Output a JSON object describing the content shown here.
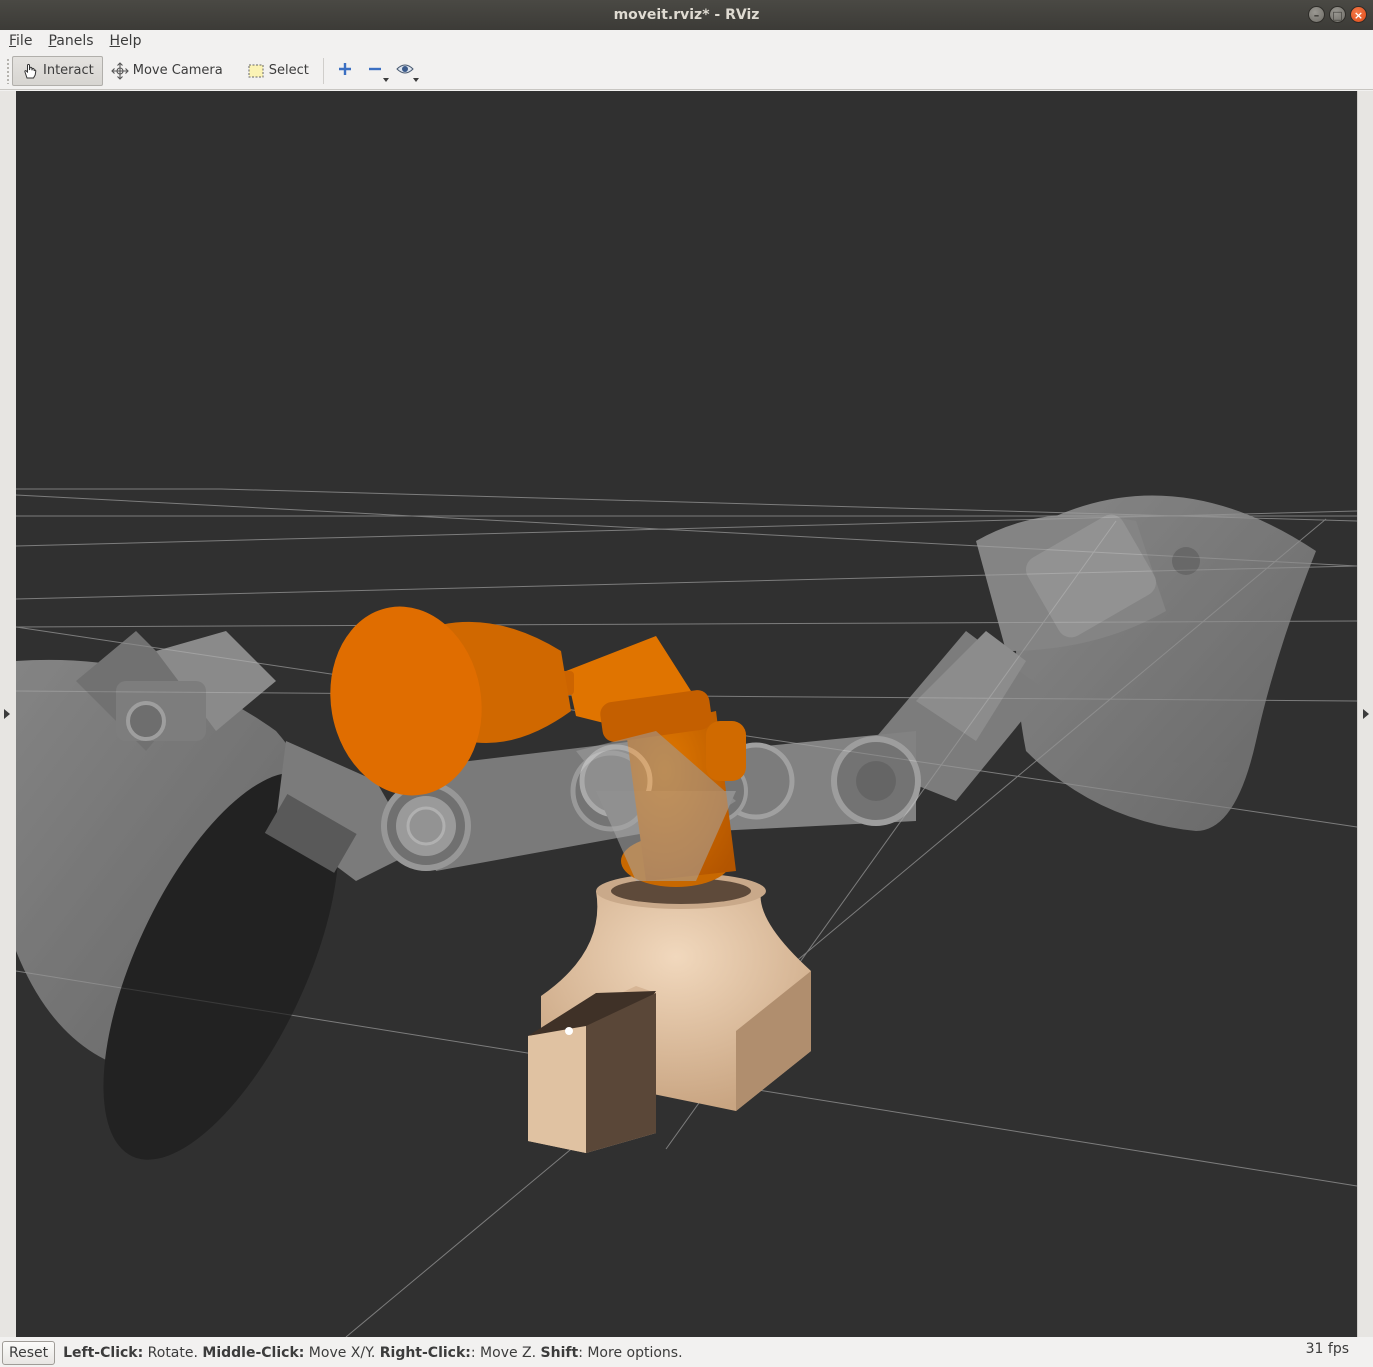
{
  "window": {
    "title": "moveit.rviz* - RViz",
    "controls": [
      "minimize",
      "maximize",
      "close"
    ]
  },
  "menubar": {
    "items": [
      {
        "mnemonic": "F",
        "rest": "ile"
      },
      {
        "mnemonic": "P",
        "rest": "anels"
      },
      {
        "mnemonic": "H",
        "rest": "elp"
      }
    ]
  },
  "toolbar": {
    "interact_label": "Interact",
    "move_camera_label": "Move Camera",
    "select_label": "Select",
    "active_tool": "Interact",
    "icons": [
      "hand-icon",
      "move-camera-icon",
      "select-icon",
      "add-tool-icon",
      "remove-tool-icon",
      "view-icon"
    ]
  },
  "viewport": {
    "background": "#303030",
    "robot_color": "#d96f00",
    "ghost_color": "#9a9a9a",
    "base_color": "#d9b896"
  },
  "statusbar": {
    "reset_label": "Reset",
    "hint": [
      {
        "bold": "Left-Click:",
        "text": " Rotate. "
      },
      {
        "bold": "Middle-Click:",
        "text": " Move X/Y. "
      },
      {
        "bold": "Right-Click:",
        "text": ": Move Z. "
      },
      {
        "bold": "Shift",
        "text": ": More options."
      }
    ],
    "fps": "31 fps"
  }
}
